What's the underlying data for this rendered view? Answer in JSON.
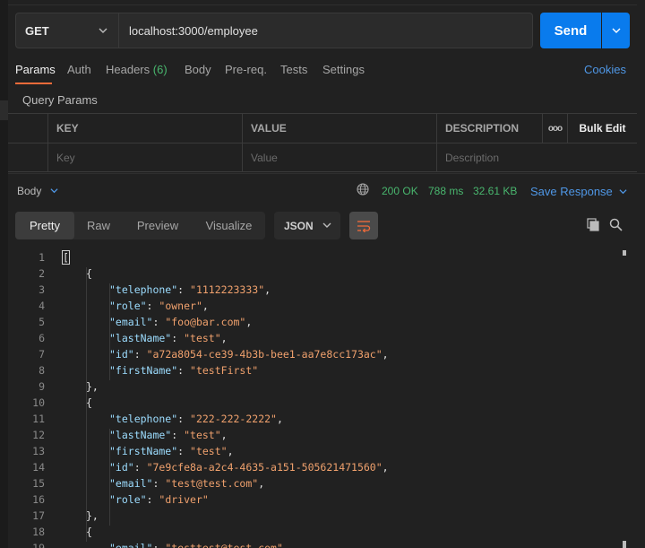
{
  "request": {
    "method": "GET",
    "url": "localhost:3000/employee",
    "send_label": "Send"
  },
  "tabs": [
    {
      "label": "Params",
      "active": true
    },
    {
      "label": "Auth"
    },
    {
      "label": "Headers",
      "count": "(6)"
    },
    {
      "label": "Body"
    },
    {
      "label": "Pre-req."
    },
    {
      "label": "Tests"
    },
    {
      "label": "Settings"
    }
  ],
  "cookies_label": "Cookies",
  "query_params": {
    "title": "Query Params",
    "headers": [
      "KEY",
      "VALUE",
      "DESCRIPTION"
    ],
    "more": "ooo",
    "bulk_edit": "Bulk Edit",
    "placeholders": [
      "Key",
      "Value",
      "Description"
    ]
  },
  "response": {
    "body_label": "Body",
    "status": "200 OK",
    "time": "788 ms",
    "size": "32.61 KB",
    "save_label": "Save Response",
    "views": [
      "Pretty",
      "Raw",
      "Preview",
      "Visualize"
    ],
    "active_view": "Pretty",
    "format": "JSON"
  },
  "code_lines": [
    {
      "n": "1",
      "indent": 0,
      "text": "["
    },
    {
      "n": "2",
      "indent": 1,
      "text": "{"
    },
    {
      "n": "3",
      "indent": 2,
      "key": "\"telephone\"",
      "value": "\"1112223333\"",
      "comma": true
    },
    {
      "n": "4",
      "indent": 2,
      "key": "\"role\"",
      "value": "\"owner\"",
      "comma": true
    },
    {
      "n": "5",
      "indent": 2,
      "key": "\"email\"",
      "value": "\"foo@bar.com\"",
      "comma": true
    },
    {
      "n": "6",
      "indent": 2,
      "key": "\"lastName\"",
      "value": "\"test\"",
      "comma": true
    },
    {
      "n": "7",
      "indent": 2,
      "key": "\"id\"",
      "value": "\"a72a8054-ce39-4b3b-bee1-aa7e8cc173ac\"",
      "comma": true
    },
    {
      "n": "8",
      "indent": 2,
      "key": "\"firstName\"",
      "value": "\"testFirst\"",
      "comma": false
    },
    {
      "n": "9",
      "indent": 1,
      "text": "},"
    },
    {
      "n": "10",
      "indent": 1,
      "text": "{"
    },
    {
      "n": "11",
      "indent": 2,
      "key": "\"telephone\"",
      "value": "\"222-222-2222\"",
      "comma": true
    },
    {
      "n": "12",
      "indent": 2,
      "key": "\"lastName\"",
      "value": "\"test\"",
      "comma": true
    },
    {
      "n": "13",
      "indent": 2,
      "key": "\"firstName\"",
      "value": "\"test\"",
      "comma": true
    },
    {
      "n": "14",
      "indent": 2,
      "key": "\"id\"",
      "value": "\"7e9cfe8a-a2c4-4635-a151-505621471560\"",
      "comma": true
    },
    {
      "n": "15",
      "indent": 2,
      "key": "\"email\"",
      "value": "\"test@test.com\"",
      "comma": true
    },
    {
      "n": "16",
      "indent": 2,
      "key": "\"role\"",
      "value": "\"driver\"",
      "comma": false
    },
    {
      "n": "17",
      "indent": 1,
      "text": "},"
    },
    {
      "n": "18",
      "indent": 1,
      "text": "{"
    },
    {
      "n": "19",
      "indent": 2,
      "key": "\"email\"",
      "value": "\"testtest@test.com\"",
      "comma": true
    }
  ],
  "icons": {
    "method_dropdown": "chevron-down-icon",
    "send_dropdown": "chevron-down-icon",
    "globe": "globe-icon",
    "wrap": "wrap-lines-icon",
    "copy": "copy-icon",
    "search": "search-icon"
  },
  "colors": {
    "accent": "#097bed",
    "active_tab": "#f26b3a",
    "status_ok": "#49b66e",
    "link": "#4f97e6",
    "json_key": "#9cdcfe",
    "json_string": "#f0a16d"
  }
}
